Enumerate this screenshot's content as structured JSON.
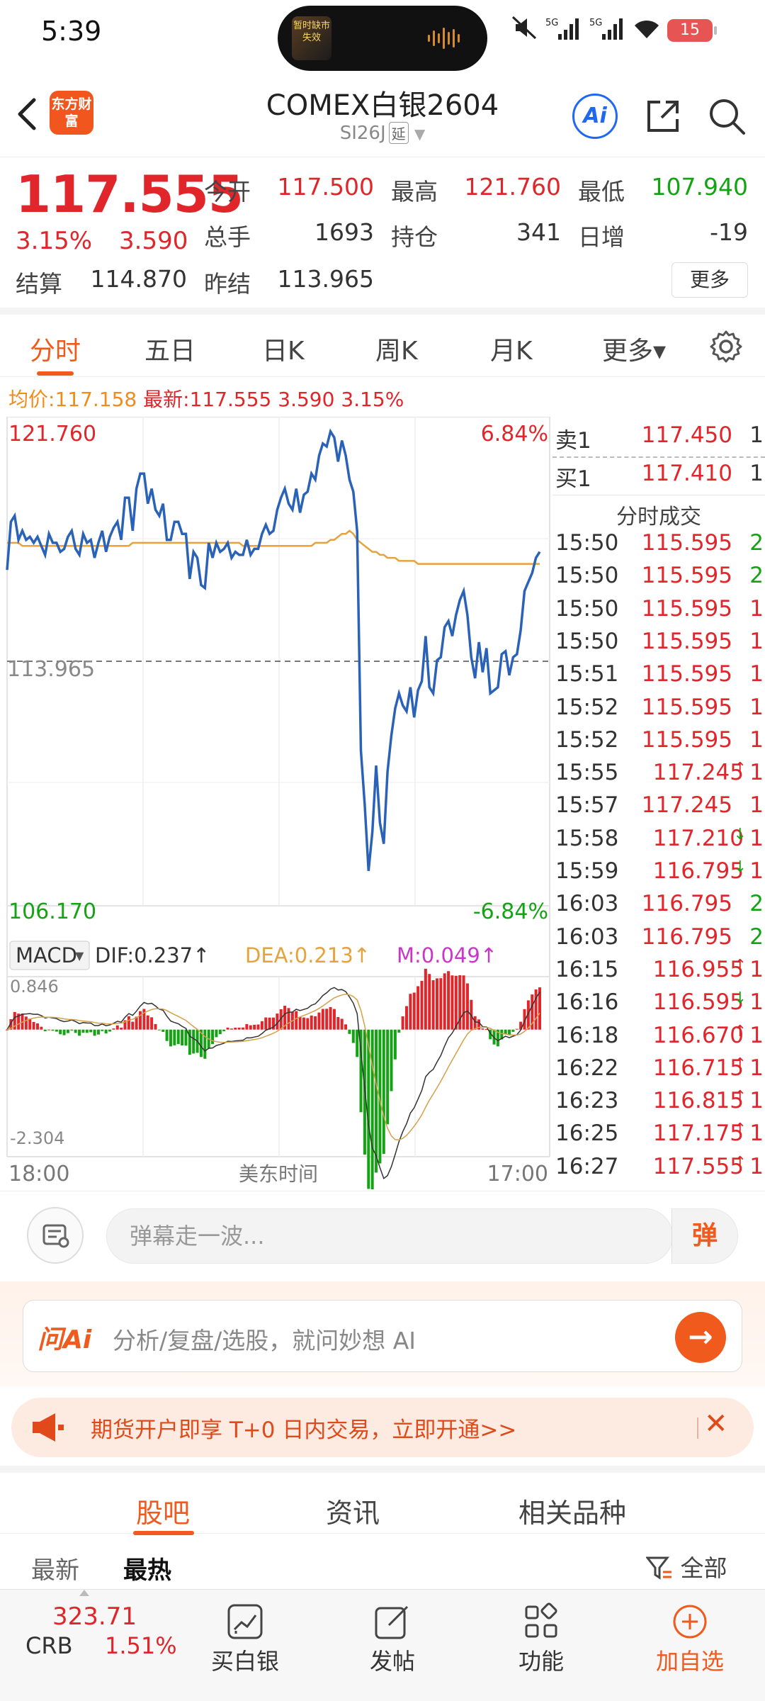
{
  "status": {
    "time": "5:39",
    "battery": "15",
    "network": "5G",
    "island_text": "暂时缺市失效"
  },
  "header": {
    "title": "COMEX白银2604",
    "code": "SI26J",
    "delay_tag": "延",
    "logo_text": "东方财富",
    "ai_label": "Ai"
  },
  "quote": {
    "price": "117.555",
    "change_pct": "3.15%",
    "change_abs": "3.590",
    "open_label": "今开",
    "open": "117.500",
    "high_label": "最高",
    "high": "121.760",
    "low_label": "最低",
    "low": "107.940",
    "volume_label": "总手",
    "volume": "1693",
    "position_label": "持仓",
    "position": "341",
    "daily_change_label": "日增",
    "daily_change": "-19",
    "settle_label": "结算",
    "settle": "114.870",
    "prev_settle_label": "昨结",
    "prev_settle": "113.965",
    "more_label": "更多"
  },
  "tabs": [
    "分时",
    "五日",
    "日K",
    "周K",
    "月K",
    "更多▾"
  ],
  "info": {
    "avg_label": "均价:",
    "avg": "117.158",
    "latest_label": "最新:",
    "latest": "117.555",
    "chg": "3.590",
    "pct": "3.15%"
  },
  "chart_data": {
    "type": "line",
    "title": "",
    "y_top": "121.760",
    "y_mid": "113.965",
    "y_bottom": "106.170",
    "pct_top": "6.84%",
    "pct_bottom": "-6.84%",
    "ylim": [
      106.17,
      121.76
    ],
    "ref_price": 113.965,
    "x_start": "18:00",
    "x_mid": "美东时间",
    "x_end": "17:00",
    "price_series": [
      117.0,
      118.6,
      118.8,
      118.0,
      118.3,
      118.0,
      118.1,
      117.9,
      118.1,
      117.8,
      117.5,
      118.2,
      117.9,
      117.9,
      117.6,
      117.7,
      118.1,
      118.3,
      117.7,
      117.5,
      118.2,
      117.9,
      118.0,
      117.4,
      117.9,
      118.3,
      117.6,
      118.1,
      118.4,
      118.6,
      118.0,
      119.4,
      119.4,
      118.3,
      119.7,
      120.2,
      120.2,
      119.2,
      119.7,
      119.0,
      118.8,
      119.2,
      118.0,
      118.0,
      118.6,
      118.6,
      118.2,
      118.2,
      116.7,
      117.6,
      117.4,
      116.5,
      116.4,
      117.9,
      117.4,
      117.9,
      117.6,
      117.7,
      117.9,
      117.4,
      117.6,
      117.5,
      117.5,
      118.0,
      117.5,
      117.7,
      117.7,
      118.2,
      118.5,
      118.2,
      118.3,
      119.0,
      119.4,
      119.7,
      119.2,
      119.0,
      119.7,
      118.9,
      119.5,
      119.6,
      120.2,
      120.0,
      120.8,
      121.2,
      121.1,
      121.6,
      121.4,
      120.6,
      121.3,
      120.8,
      120.0,
      119.6,
      118.3,
      111.0,
      109.2,
      107.0,
      108.3,
      110.5,
      108.6,
      107.9,
      110.3,
      111.5,
      112.4,
      112.9,
      112.5,
      112.3,
      113.1,
      112.1,
      113.0,
      113.3,
      114.8,
      113.1,
      112.9,
      114.0,
      114.1,
      115.1,
      115.3,
      114.8,
      115.5,
      116.0,
      116.3,
      115.5,
      114.1,
      113.4,
      114.6,
      113.6,
      114.4,
      112.9,
      113.0,
      113.1,
      114.2,
      114.3,
      113.5,
      114.1,
      114.2,
      115.0,
      116.3,
      116.6,
      116.9,
      117.4,
      117.6
    ],
    "avg_series": [
      117.9,
      117.9,
      117.9,
      117.9,
      117.8,
      117.8,
      117.8,
      117.8,
      117.8,
      117.8,
      117.8,
      117.8,
      117.8,
      117.8,
      117.8,
      117.8,
      117.8,
      117.8,
      117.8,
      117.8,
      117.8,
      117.8,
      117.8,
      117.8,
      117.8,
      117.8,
      117.8,
      117.8,
      117.8,
      117.8,
      117.8,
      117.8,
      117.8,
      117.9,
      117.9,
      117.9,
      117.9,
      117.9,
      117.9,
      117.9,
      117.9,
      117.9,
      117.9,
      117.9,
      117.9,
      117.9,
      117.9,
      117.9,
      117.9,
      117.9,
      117.9,
      117.9,
      117.9,
      117.9,
      117.9,
      117.9,
      117.9,
      117.9,
      117.9,
      117.9,
      117.9,
      117.9,
      117.8,
      117.8,
      117.8,
      117.8,
      117.8,
      117.8,
      117.8,
      117.8,
      117.8,
      117.8,
      117.8,
      117.8,
      117.8,
      117.8,
      117.8,
      117.8,
      117.8,
      117.8,
      117.8,
      117.9,
      117.9,
      117.9,
      117.9,
      118.0,
      118.0,
      118.1,
      118.2,
      118.2,
      118.3,
      118.2,
      118.0,
      117.9,
      117.8,
      117.7,
      117.6,
      117.6,
      117.5,
      117.5,
      117.4,
      117.4,
      117.4,
      117.3,
      117.3,
      117.3,
      117.3,
      117.3,
      117.2,
      117.2,
      117.2,
      117.2,
      117.2,
      117.2,
      117.2,
      117.2,
      117.2,
      117.2,
      117.2,
      117.2,
      117.2,
      117.2,
      117.2,
      117.2,
      117.2,
      117.2,
      117.2,
      117.2,
      117.2,
      117.2,
      117.2,
      117.2,
      117.2,
      117.2,
      117.2,
      117.2,
      117.2,
      117.2,
      117.2,
      117.2,
      117.2
    ],
    "macd": {
      "label": "MACD",
      "dif": "DIF:0.237↑",
      "dea": "DEA:0.213↑",
      "m": "M:0.049↑",
      "top": "0.846",
      "bottom": "-2.304",
      "ylim": [
        -2.304,
        0.846
      ]
    }
  },
  "trades": {
    "sell1_label": "卖1",
    "sell1_price": "117.450",
    "sell1_vol": "1",
    "buy1_label": "买1",
    "buy1_price": "117.410",
    "buy1_vol": "1",
    "header": "分时成交",
    "rows": [
      {
        "time": "15:50",
        "price": "115.595",
        "arrow": "",
        "vol": "2"
      },
      {
        "time": "15:50",
        "price": "115.595",
        "arrow": "",
        "vol": "2"
      },
      {
        "time": "15:50",
        "price": "115.595",
        "arrow": "",
        "vol": "1"
      },
      {
        "time": "15:50",
        "price": "115.595",
        "arrow": "",
        "vol": "1"
      },
      {
        "time": "15:51",
        "price": "115.595",
        "arrow": "",
        "vol": "1"
      },
      {
        "time": "15:52",
        "price": "115.595",
        "arrow": "",
        "vol": "1"
      },
      {
        "time": "15:52",
        "price": "115.595",
        "arrow": "",
        "vol": "1"
      },
      {
        "time": "15:55",
        "price": "117.245",
        "arrow": "↑",
        "vol": "1"
      },
      {
        "time": "15:57",
        "price": "117.245",
        "arrow": "",
        "vol": "1"
      },
      {
        "time": "15:58",
        "price": "117.210",
        "arrow": "↓",
        "vol": "1"
      },
      {
        "time": "15:59",
        "price": "116.795",
        "arrow": "↓",
        "vol": "1"
      },
      {
        "time": "16:03",
        "price": "116.795",
        "arrow": "",
        "vol": "2"
      },
      {
        "time": "16:03",
        "price": "116.795",
        "arrow": "",
        "vol": "2"
      },
      {
        "time": "16:15",
        "price": "116.955",
        "arrow": "↑",
        "vol": "1"
      },
      {
        "time": "16:16",
        "price": "116.595",
        "arrow": "↓",
        "vol": "1"
      },
      {
        "time": "16:18",
        "price": "116.670",
        "arrow": "↑",
        "vol": "1"
      },
      {
        "time": "16:22",
        "price": "116.715",
        "arrow": "↑",
        "vol": "1"
      },
      {
        "time": "16:23",
        "price": "116.815",
        "arrow": "↑",
        "vol": "1"
      },
      {
        "time": "16:25",
        "price": "117.175",
        "arrow": "↑",
        "vol": "1"
      },
      {
        "time": "16:27",
        "price": "117.555",
        "arrow": "↑",
        "vol": "1"
      }
    ]
  },
  "barrage": {
    "placeholder": "弹幕走一波...",
    "button": "弹"
  },
  "ai_bar": {
    "logo": "问Ai",
    "placeholder": "分析/复盘/选股，就问妙想 AI",
    "go": "→"
  },
  "promo": {
    "text": "期货开户即享 T+0 日内交易，立即开通>>",
    "close": "✕"
  },
  "section_tabs": [
    "股吧",
    "资讯",
    "相关品种"
  ],
  "sub_tabs": {
    "latest": "最新",
    "hot": "最热",
    "filter": "全部"
  },
  "bottom_nav": {
    "crb_price": "323.71",
    "crb_name": "CRB",
    "crb_pct": "1.51%",
    "buy": "买白银",
    "post": "发帖",
    "func": "功能",
    "add": "加自选"
  },
  "colors": {
    "up": "#e0262a",
    "down": "#13a313",
    "accent": "#f05a1d",
    "price_line": "#2a62b8",
    "avg_line": "#e6a23c"
  }
}
